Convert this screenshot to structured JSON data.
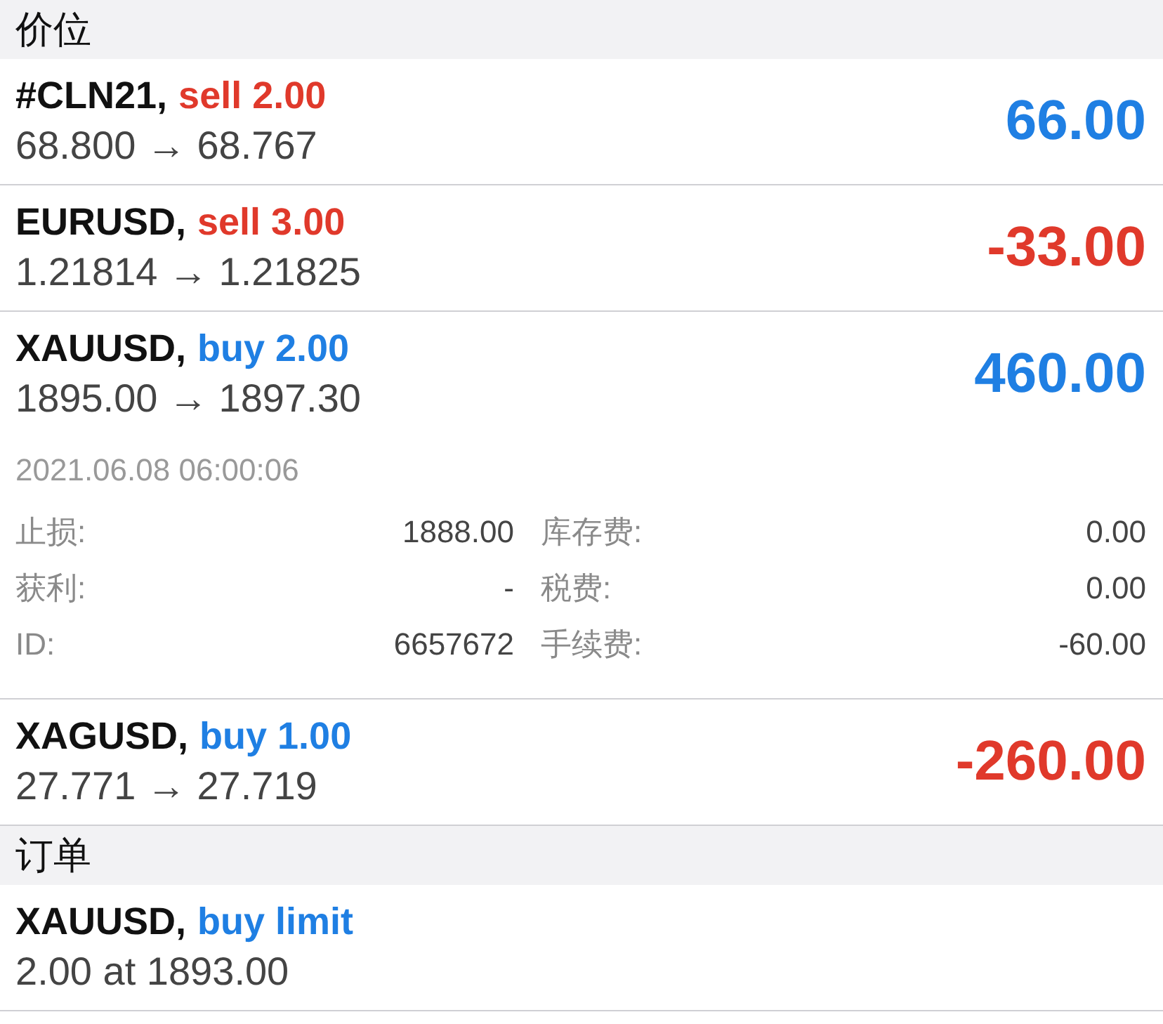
{
  "sections": [
    {
      "title": "价位",
      "rows": [
        {
          "symbol": "#CLN21,",
          "order": {
            "text": "sell 2.00",
            "color": "#e0392b"
          },
          "prices": "68.800 → 68.767",
          "profit": {
            "text": "66.00",
            "color": "#1f7fe3"
          }
        },
        {
          "symbol": "EURUSD,",
          "order": {
            "text": "sell 3.00",
            "color": "#e0392b"
          },
          "prices": "1.21814 → 1.21825",
          "profit": {
            "text": "-33.00",
            "color": "#e0392b"
          }
        },
        {
          "symbol": "XAUUSD,",
          "order": {
            "text": "buy 2.00",
            "color": "#1f7fe3"
          },
          "prices": "1895.00 → 1897.30",
          "profit": {
            "text": "460.00",
            "color": "#1f7fe3"
          },
          "expanded": true,
          "details": {
            "time": "2021.06.08 06:00:06",
            "left": [
              {
                "label": "止损:",
                "value": "1888.00"
              },
              {
                "label": "获利:",
                "value": "-"
              },
              {
                "label": "ID:",
                "value": "6657672"
              }
            ],
            "right": [
              {
                "label": "库存费:",
                "value": "0.00"
              },
              {
                "label": "税费:",
                "value": "0.00"
              },
              {
                "label": "手续费:",
                "value": "-60.00"
              }
            ]
          }
        },
        {
          "symbol": "XAGUSD,",
          "order": {
            "text": "buy 1.00",
            "color": "#1f7fe3"
          },
          "prices": "27.771 → 27.719",
          "profit": {
            "text": "-260.00",
            "color": "#e0392b"
          }
        }
      ]
    },
    {
      "title": "订单",
      "rows": [
        {
          "symbol": "XAUUSD,",
          "order": {
            "text": "buy limit",
            "color": "#1f7fe3"
          },
          "prices": "2.00 at 1893.00"
        }
      ]
    }
  ]
}
